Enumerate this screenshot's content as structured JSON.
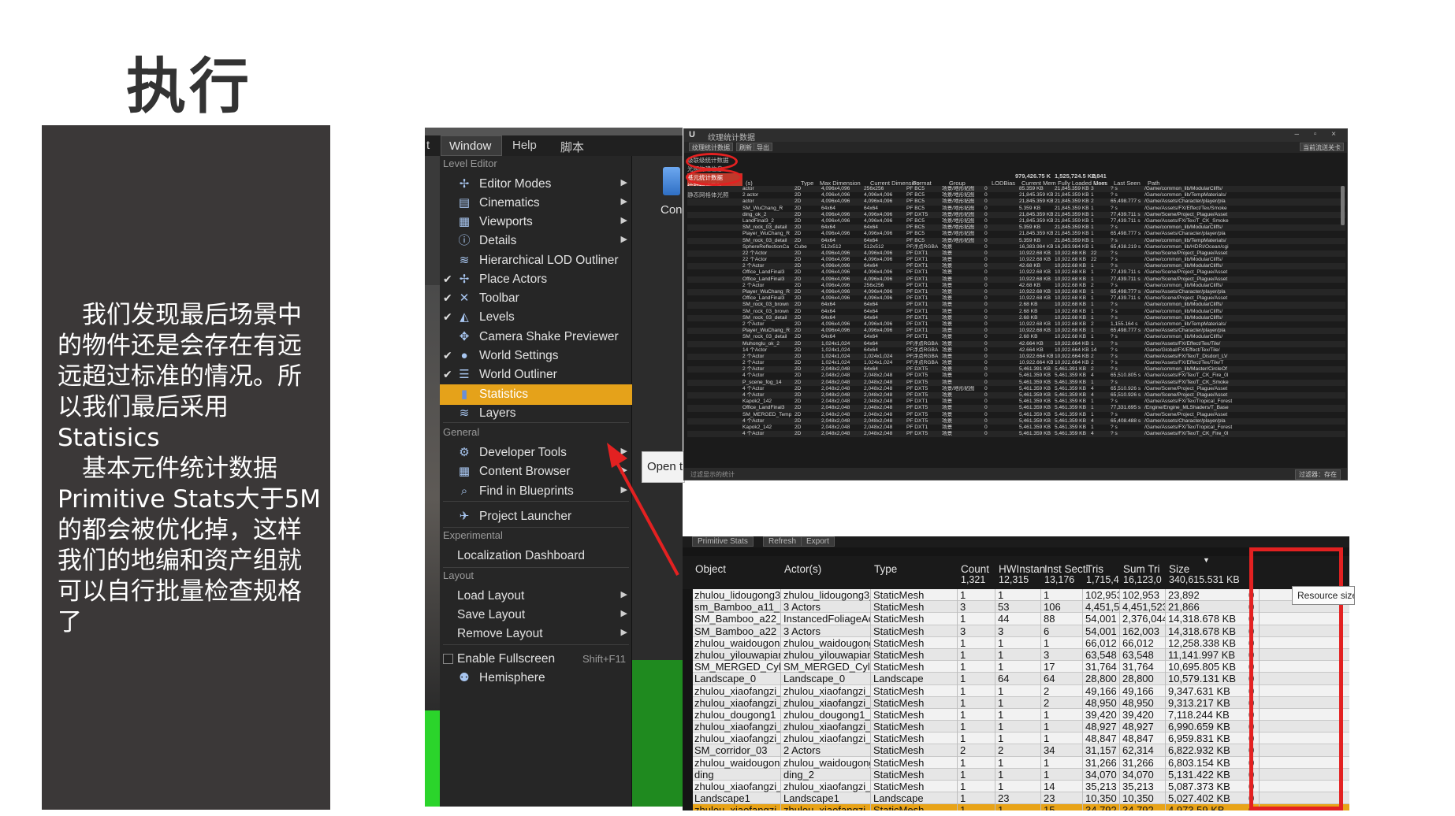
{
  "title": "执行",
  "description": "　我们发现最后场景中的物件还是会存在有远远超过标准的情况。所以我们最后采用Statisics\n　基本元件统计数据Primitive Stats大于5M的都会被优化掉，这样我们的地编和资产组就可以自行批量检查规格了",
  "menu": {
    "menubar": [
      "Window",
      "Help",
      "脚本"
    ],
    "left_stub": "nt",
    "con_label": "Con",
    "open_button": "Open t",
    "sections": {
      "level_editor": "Level Editor",
      "general": "General",
      "experimental": "Experimental",
      "layout": "Layout"
    },
    "level_editor_items": [
      {
        "label": "Editor Modes",
        "icon": "editor-modes-icon",
        "checked": false,
        "submenu": true
      },
      {
        "label": "Cinematics",
        "icon": "cinematics-icon",
        "checked": false,
        "submenu": true
      },
      {
        "label": "Viewports",
        "icon": "viewports-icon",
        "checked": false,
        "submenu": true
      },
      {
        "label": "Details",
        "icon": "details-icon",
        "checked": false,
        "submenu": true
      },
      {
        "label": "Hierarchical LOD Outliner",
        "icon": "hlod-icon",
        "checked": false,
        "submenu": false
      },
      {
        "label": "Place Actors",
        "icon": "place-actors-icon",
        "checked": true,
        "submenu": false
      },
      {
        "label": "Toolbar",
        "icon": "toolbar-icon",
        "checked": true,
        "submenu": false
      },
      {
        "label": "Levels",
        "icon": "levels-icon",
        "checked": true,
        "submenu": false
      },
      {
        "label": "Camera Shake Previewer",
        "icon": "camera-shake-icon",
        "checked": false,
        "submenu": false
      },
      {
        "label": "World Settings",
        "icon": "world-settings-icon",
        "checked": true,
        "submenu": false
      },
      {
        "label": "World Outliner",
        "icon": "world-outliner-icon",
        "checked": true,
        "submenu": false
      },
      {
        "label": "Statistics",
        "icon": "statistics-icon",
        "checked": false,
        "submenu": false,
        "highlighted": true
      },
      {
        "label": "Layers",
        "icon": "layers-icon",
        "checked": false,
        "submenu": false
      }
    ],
    "general_items": [
      {
        "label": "Developer Tools",
        "icon": "developer-tools-icon",
        "submenu": true
      },
      {
        "label": "Content Browser",
        "icon": "content-browser-icon",
        "submenu": true
      },
      {
        "label": "Find in Blueprints",
        "icon": "find-blueprints-icon",
        "submenu": true
      },
      {
        "label": "Project Launcher",
        "icon": "project-launcher-icon",
        "submenu": false
      }
    ],
    "experimental_items": [
      {
        "label": "Localization Dashboard"
      }
    ],
    "layout_items": [
      {
        "label": "Load Layout",
        "submenu": true
      },
      {
        "label": "Save Layout",
        "submenu": true
      },
      {
        "label": "Remove Layout",
        "submenu": true
      }
    ],
    "fullscreen": {
      "label": "Enable Fullscreen",
      "shortcut": "Shift+F11"
    },
    "hemisphere": {
      "label": "Hemisphere",
      "icon": "hemisphere-icon"
    }
  },
  "texture_stats": {
    "window_title": "纹理统计数据",
    "toolbar": [
      "纹理统计数据",
      "刷新",
      "导出"
    ],
    "toolbar_right": "当前流送关卡",
    "tree": [
      "级联级统计数据",
      "光照构建信息",
      "基元统计数据",
      "纹理统计数据",
      "静态网格体光照"
    ],
    "headers": [
      "(s)",
      "Type",
      "Max Dimension",
      "Current Dimension",
      "Format",
      "Group",
      "LODBias",
      "Current Mem",
      "Fully Loaded Mem",
      "Uses",
      "Last Seen",
      "Path"
    ],
    "totals": {
      "current_mem": "979,426.75 K",
      "fully_loaded": "1,525,724.5 KB",
      "uses": "2,841"
    },
    "footer_left": "过滤显示的统计",
    "footer_right": "过滤器：存在",
    "rows": [
      [
        "actor",
        "2D",
        "4,096x4,096",
        "256x256",
        "PF BC5",
        "场景/地形贴图",
        "0",
        "85.359 KB",
        "21,845.359 KB",
        "3",
        "? s",
        "/Game/common_lib/ModularCliffs/"
      ],
      [
        "2 actor",
        "2D",
        "4,096x4,096",
        "4,096x4,096",
        "PF BC5",
        "场景/地形贴图",
        "0",
        "21,845.359 KB",
        "21,845.359 KB",
        "1",
        "? s",
        "/Game/common_lib/TempMaterials/"
      ],
      [
        "actor",
        "2D",
        "4,096x4,096",
        "4,096x4,096",
        "PF BC5",
        "场景/地形贴图",
        "0",
        "21,845.359 KB",
        "21,845.359 KB",
        "2",
        "65,498.777 s",
        "/Game/Assets/Character/player/pla"
      ],
      [
        "SM_WuChang_R",
        "2D",
        "64x64",
        "64x64",
        "PF BC5",
        "场景/地形贴图",
        "0",
        "5.359 KB",
        "21,845.359 KB",
        "1",
        "? s",
        "/Game/Assets/FX/Effect/Tex/Smoke"
      ],
      [
        "ding_ok_2",
        "2D",
        "4,096x4,096",
        "4,096x4,096",
        "PF DXT5",
        "场景/地形贴图",
        "0",
        "21,845.359 KB",
        "21,845.359 KB",
        "1",
        "77,439.711 s",
        "/Game/Scene/Project_Plague/Asset"
      ],
      [
        "LandFinal3_2",
        "2D",
        "4,096x4,096",
        "4,096x4,096",
        "PF BC5",
        "场景/地形贴图",
        "0",
        "21,845.359 KB",
        "21,845.359 KB",
        "1",
        "77,439.711 s",
        "/Game/Assets/FX/Tex/T_CK_Smoke"
      ],
      [
        "SM_rock_03_detail",
        "2D",
        "64x64",
        "64x64",
        "PF BC5",
        "场景/地形贴图",
        "0",
        "5.359 KB",
        "21,845.359 KB",
        "1",
        "? s",
        "/Game/common_lib/ModularCliffs/"
      ],
      [
        "Player_WuChang_R",
        "2D",
        "4,096x4,096",
        "4,096x4,096",
        "PF BC5",
        "场景/地形贴图",
        "0",
        "21,845.359 KB",
        "21,845.359 KB",
        "1",
        "65,498.777 s",
        "/Game/Assets/Character/player/pla"
      ],
      [
        "SM_rock_03_detail",
        "2D",
        "64x64",
        "64x64",
        "PF BC5",
        "场景/地形贴图",
        "0",
        "5.359 KB",
        "21,845.359 KB",
        "1",
        "? s",
        "/Game/common_lib/TempMaterials/"
      ],
      [
        "SphereReflectionCa",
        "Cube",
        "512x512",
        "512x512",
        "PF浮点RGBA",
        "场景",
        "0",
        "16,383.984 KB",
        "16,383.984 KB",
        "1",
        "65,438.219 s",
        "/Game/common_lib/HDRI/Ocean/cgi"
      ],
      [
        "22 个Actor",
        "2D",
        "4,096x4,096",
        "4,096x4,096",
        "PF DXT1",
        "场景",
        "0",
        "10,922.68 KB",
        "10,922.68 KB",
        "22",
        "? s",
        "/Game/Scene/Project_Plague/Asset"
      ],
      [
        "22 个Actor",
        "2D",
        "4,096x4,096",
        "4,096x4,096",
        "PF DXT1",
        "场景",
        "0",
        "10,922.68 KB",
        "10,922.68 KB",
        "22",
        "? s",
        "/Game/common_lib/ModularCliffs/"
      ],
      [
        "2 个Actor",
        "2D",
        "4,096x4,096",
        "64x64",
        "PF DXT1",
        "场景",
        "0",
        "42.68 KB",
        "10,922.68 KB",
        "1",
        "? s",
        "/Game/common_lib/ModularCliffs/"
      ],
      [
        "Office_LandFinal3",
        "2D",
        "4,096x4,096",
        "4,096x4,096",
        "PF DXT1",
        "场景",
        "0",
        "10,922.68 KB",
        "10,922.68 KB",
        "1",
        "77,439.711 s",
        "/Game/Scene/Project_Plague/Asset"
      ],
      [
        "Office_LandFinal3",
        "2D",
        "4,096x4,096",
        "4,096x4,096",
        "PF DXT1",
        "场景",
        "0",
        "10,922.68 KB",
        "10,922.68 KB",
        "1",
        "77,439.711 s",
        "/Game/Scene/Project_Plague/Asset"
      ],
      [
        "2 个Actor",
        "2D",
        "4,096x4,096",
        "256x256",
        "PF DXT1",
        "场景",
        "0",
        "42.68 KB",
        "10,922.68 KB",
        "2",
        "? s",
        "/Game/common_lib/ModularCliffs/"
      ],
      [
        "Player_WuChang_R",
        "2D",
        "4,096x4,096",
        "4,096x4,096",
        "PF DXT1",
        "场景",
        "0",
        "10,922.68 KB",
        "10,922.68 KB",
        "1",
        "65,498.777 s",
        "/Game/Assets/Character/player/pla"
      ],
      [
        "Office_LandFinal3",
        "2D",
        "4,096x4,096",
        "4,096x4,096",
        "PF DXT1",
        "场景",
        "0",
        "10,922.68 KB",
        "10,922.68 KB",
        "1",
        "77,439.711 s",
        "/Game/Scene/Project_Plague/Asset"
      ],
      [
        "SM_rock_03_brown",
        "2D",
        "64x64",
        "64x64",
        "PF DXT1",
        "场景",
        "0",
        "2.68 KB",
        "10,922.68 KB",
        "1",
        "? s",
        "/Game/common_lib/ModularCliffs/"
      ],
      [
        "SM_rock_03_brown",
        "2D",
        "64x64",
        "64x64",
        "PF DXT1",
        "场景",
        "0",
        "2.68 KB",
        "10,922.68 KB",
        "1",
        "? s",
        "/Game/common_lib/ModularCliffs/"
      ],
      [
        "SM_rock_03_detail",
        "2D",
        "64x64",
        "64x64",
        "PF DXT1",
        "场景",
        "0",
        "2.68 KB",
        "10,922.68 KB",
        "1",
        "? s",
        "/Game/common_lib/ModularCliffs/"
      ],
      [
        "2 个Actor",
        "2D",
        "4,096x4,096",
        "4,096x4,096",
        "PF DXT1",
        "场景",
        "0",
        "10,922.68 KB",
        "10,922.68 KB",
        "2",
        "1,155.164 s",
        "/Game/common_lib/TempMaterials/"
      ],
      [
        "Player_WuChang_R",
        "2D",
        "4,096x4,096",
        "4,096x4,096",
        "PF DXT1",
        "场景",
        "0",
        "10,922.68 KB",
        "10,922.68 KB",
        "1",
        "65,498.777 s",
        "/Game/Assets/Character/player/pla"
      ],
      [
        "SM_rock_03_detail",
        "2D",
        "64x64",
        "64x64",
        "PF DXT1",
        "场景",
        "0",
        "2.68 KB",
        "10,922.68 KB",
        "1",
        "? s",
        "/Game/common_lib/ModularCliffs/"
      ],
      [
        "Muhonglu_ok_2",
        "2D",
        "1,024x1,024",
        "64x64",
        "PF浮点RGBA",
        "场景",
        "0",
        "42.664 KB",
        "10,922.664 KB",
        "1",
        "? s",
        "/Game/Assets/FX/Effect/Tex/Tile/"
      ],
      [
        "14 个Actor",
        "2D",
        "1,024x1,024",
        "64x64",
        "PF浮点RGBA",
        "场景",
        "0",
        "42.664 KB",
        "10,922.664 KB",
        "14",
        "? s",
        "/Game/Global/FX/Effect/Tex/Tile/"
      ],
      [
        "2 个Actor",
        "2D",
        "1,024x1,024",
        "1,024x1,024",
        "PF浮点RGBA",
        "场景",
        "0",
        "10,922.664 KB",
        "10,922.664 KB",
        "2",
        "? s",
        "/Game/Assets/FX/Tex/T_Disdort_LV"
      ],
      [
        "2 个Actor",
        "2D",
        "1,024x1,024",
        "1,024x1,024",
        "PF浮点RGBA",
        "场景",
        "0",
        "10,922.664 KB",
        "10,922.664 KB",
        "2",
        "? s",
        "/Game/Assets/FX/Effect/Tex/Tile/T"
      ],
      [
        "2 个Actor",
        "2D",
        "2,048x2,048",
        "64x64",
        "PF DXT5",
        "场景",
        "0",
        "5,461.391 KB",
        "5,461.391 KB",
        "2",
        "? s",
        "/Game/common_lib/Master/CircleOf"
      ],
      [
        "4 个Actor",
        "2D",
        "2,048x2,048",
        "2,048x2,048",
        "PF DXT5",
        "场景",
        "0",
        "5,461.359 KB",
        "5,461.359 KB",
        "4",
        "65,510.805 s",
        "/Game/Assets/FX/Tex/T_CK_Fire_0l"
      ],
      [
        "P_scene_fog_14",
        "2D",
        "2,048x2,048",
        "2,048x2,048",
        "PF DXT5",
        "场景",
        "0",
        "5,461.359 KB",
        "5,461.359 KB",
        "1",
        "? s",
        "/Game/Assets/FX/Tex/T_CK_Smoke"
      ],
      [
        "4 个Actor",
        "2D",
        "2,048x2,048",
        "2,048x2,048",
        "PF DXT5",
        "场景/地形贴图",
        "0",
        "5,461.359 KB",
        "5,461.359 KB",
        "4",
        "65,510.926 s",
        "/Game/Scene/Project_Plague/Asset"
      ],
      [
        "4 个Actor",
        "2D",
        "2,048x2,048",
        "2,048x2,048",
        "PF DXT5",
        "场景",
        "0",
        "5,461.359 KB",
        "5,461.359 KB",
        "4",
        "65,510.926 s",
        "/Game/Scene/Project_Plague/Asset"
      ],
      [
        "Kapok2_142",
        "2D",
        "2,048x2,048",
        "2,048x2,048",
        "PF DXT1",
        "场景",
        "0",
        "5,461.359 KB",
        "5,461.359 KB",
        "1",
        "? s",
        "/Game/Assets/FX/Tex/Tropical_Forest"
      ],
      [
        "Office_LandFinal3",
        "2D",
        "2,048x2,048",
        "2,048x2,048",
        "PF DXT5",
        "场景",
        "0",
        "5,461.359 KB",
        "5,461.359 KB",
        "1",
        "77,331.695 s",
        "/Engine/Engine_MLShaders/T_Base"
      ],
      [
        "SM_MERGED_Temp",
        "2D",
        "2,048x2,048",
        "2,048x2,048",
        "PF DXT5",
        "场景",
        "0",
        "5,461.359 KB",
        "5,461.359 KB",
        "1",
        "? s",
        "/Game/Scene/Project_Plague/Asset"
      ],
      [
        "4 个Actor",
        "2D",
        "2,048x2,048",
        "2,048x2,048",
        "PF DXT5",
        "场景",
        "0",
        "5,461.359 KB",
        "5,461.359 KB",
        "4",
        "65,408.488 s",
        "/Game/Assets/Character/player/pla"
      ],
      [
        "Kapok2_142",
        "2D",
        "2,048x2,048",
        "2,048x2,048",
        "PF DXT1",
        "场景",
        "0",
        "5,461.359 KB",
        "5,461.359 KB",
        "1",
        "? s",
        "/Game/Assets/FX/Tex/Tropical_Forest"
      ],
      [
        "4 个Actor",
        "2D",
        "2,048x2,048",
        "2,048x2,048",
        "PF DXT5",
        "场景",
        "0",
        "5,461.359 KB",
        "5,461.359 KB",
        "4",
        "? s",
        "/Game/Assets/FX/Tex/T_CK_Fire_0l"
      ]
    ]
  },
  "primitive_stats": {
    "tabs": [
      "Primitive Stats",
      "Refresh",
      "Export"
    ],
    "headers": [
      "Object",
      "Actor(s)",
      "Type",
      "Count",
      "HWInstan",
      "Inst Secti",
      "Tris",
      "Sum Tri",
      "Size"
    ],
    "totals": [
      "",
      "",
      "",
      "1,321",
      "12,315",
      "13,176",
      "1,715,4",
      "16,123,0",
      "340,615.531 KB"
    ],
    "tooltip": "Resource size",
    "rows": [
      [
        "zhulou_lidougong3",
        "zhulou_lidougong3_49",
        "StaticMesh",
        "1",
        "1",
        "1",
        "102,953",
        "102,953",
        "23,892"
      ],
      [
        "sm_Bamboo_a11_2",
        "3 Actors",
        "StaticMesh",
        "3",
        "53",
        "106",
        "4,451,523",
        "4,451,523",
        "21,866"
      ],
      [
        "SM_Bamboo_a22_2",
        "InstancedFoliageActor",
        "StaticMesh",
        "1",
        "44",
        "88",
        "54,001",
        "2,376,044",
        "14,318.678 KB"
      ],
      [
        "SM_Bamboo_a22",
        "3 Actors",
        "StaticMesh",
        "3",
        "3",
        "6",
        "54,001",
        "162,003",
        "14,318.678 KB"
      ],
      [
        "zhulou_waidougong_0",
        "zhulou_waidougong_0",
        "StaticMesh",
        "1",
        "1",
        "1",
        "66,012",
        "66,012",
        "12,258.338 KB"
      ],
      [
        "zhulou_yilouwapian",
        "zhulou_yilouwapian_8",
        "StaticMesh",
        "1",
        "1",
        "3",
        "63,548",
        "63,548",
        "11,141.997 KB"
      ],
      [
        "SM_MERGED_Cylinder",
        "SM_MERGED_Cylinder",
        "StaticMesh",
        "1",
        "1",
        "17",
        "31,764",
        "31,764",
        "10,695.805 KB"
      ],
      [
        "Landscape_0",
        "Landscape_0",
        "Landscape",
        "1",
        "64",
        "64",
        "28,800",
        "28,800",
        "10,579.131 KB"
      ],
      [
        "zhulou_xiaofangzi_02",
        "zhulou_xiaofangzi_02",
        "StaticMesh",
        "1",
        "1",
        "2",
        "49,166",
        "49,166",
        "9,347.631 KB"
      ],
      [
        "zhulou_xiaofangzi_02",
        "zhulou_xiaofangzi_02",
        "StaticMesh",
        "1",
        "1",
        "2",
        "48,950",
        "48,950",
        "9,313.217 KB"
      ],
      [
        "zhulou_dougong1",
        "zhulou_dougong1_37",
        "StaticMesh",
        "1",
        "1",
        "1",
        "39,420",
        "39,420",
        "7,118.244 KB"
      ],
      [
        "zhulou_xiaofangzi_03",
        "zhulou_xiaofangzi_03",
        "StaticMesh",
        "1",
        "1",
        "1",
        "48,927",
        "48,927",
        "6,990.659 KB"
      ],
      [
        "zhulou_xiaofangzi_03",
        "zhulou_xiaofangzi_03",
        "StaticMesh",
        "1",
        "1",
        "1",
        "48,847",
        "48,847",
        "6,959.831 KB"
      ],
      [
        "SM_corridor_03",
        "2 Actors",
        "StaticMesh",
        "2",
        "2",
        "34",
        "31,157",
        "62,314",
        "6,822.932 KB"
      ],
      [
        "zhulou_waidougong_0",
        "zhulou_waidougong_0",
        "StaticMesh",
        "1",
        "1",
        "1",
        "31,266",
        "31,266",
        "6,803.154 KB"
      ],
      [
        "ding",
        "ding_2",
        "StaticMesh",
        "1",
        "1",
        "1",
        "34,070",
        "34,070",
        "5,131.422 KB"
      ],
      [
        "zhulou_xiaofangzi_03",
        "zhulou_xiaofangzi_03",
        "StaticMesh",
        "1",
        "1",
        "14",
        "35,213",
        "35,213",
        "5,087.373 KB"
      ],
      [
        "Landscape1",
        "Landscape1",
        "Landscape",
        "1",
        "23",
        "23",
        "10,350",
        "10,350",
        "5,027.402 KB"
      ],
      [
        "zhulou_xiaofangzi_02",
        "zhulou_xiaofangzi_02",
        "StaticMesh",
        "1",
        "1",
        "15",
        "34,792",
        "34,792",
        "4,973.59 KB"
      ]
    ]
  },
  "colors": {
    "highlight": "#e5a21a",
    "annotation_red": "#e32121",
    "left_panel": "#3b3838"
  }
}
